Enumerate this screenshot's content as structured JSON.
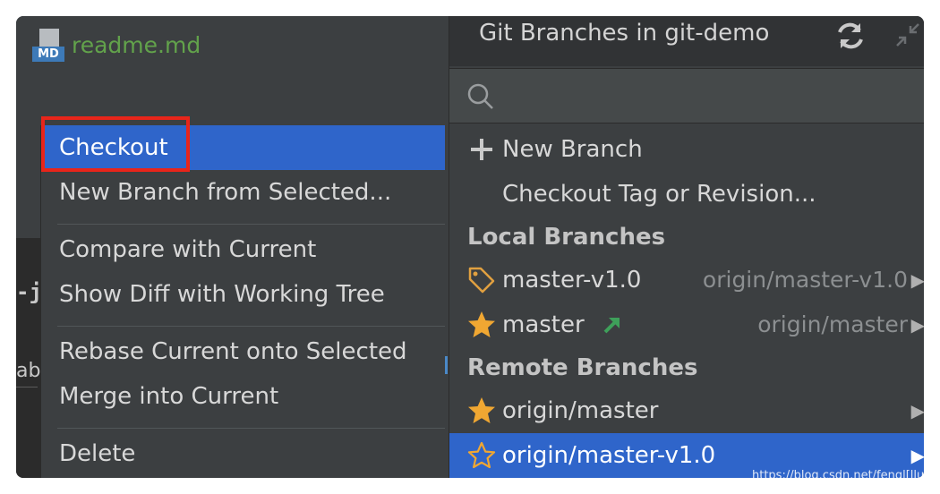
{
  "editor": {
    "file_name": "readme.md",
    "file_badge": "MD",
    "code_fragment_1": "-j",
    "code_fragment_2": "ab"
  },
  "context_menu": {
    "items": [
      {
        "label": "Checkout",
        "selected": true
      },
      {
        "label": "New Branch from Selected..."
      },
      {
        "label": "Compare with Current"
      },
      {
        "label": "Show Diff with Working Tree"
      },
      {
        "label": "Rebase Current onto Selected"
      },
      {
        "label": "Merge into Current"
      },
      {
        "label": "Delete"
      }
    ]
  },
  "branches_popup": {
    "title": "Git Branches in git-demo",
    "search_placeholder": "",
    "actions": [
      {
        "label": "New Branch",
        "icon": "plus-icon"
      },
      {
        "label": "Checkout Tag or Revision..."
      }
    ],
    "local_header": "Local Branches",
    "local": [
      {
        "name": "master-v1.0",
        "tracking": "origin/master-v1.0",
        "icon": "tag-icon"
      },
      {
        "name": "master",
        "tracking": "origin/master",
        "icon": "star-icon",
        "extra_icon": "outgoing-arrow-icon"
      }
    ],
    "remote_header": "Remote Branches",
    "remote": [
      {
        "name": "origin/master",
        "icon": "star-icon"
      },
      {
        "name": "origin/master-v1.0",
        "icon": "star-outline-icon",
        "selected": true
      }
    ]
  },
  "watermark": "https://blog.csdn.net/fengl[llu",
  "colors": {
    "selection": "#2f65ca",
    "highlight_box": "#e8251a",
    "file_name": "#62a24b",
    "star": "#f0a732",
    "arrow": "#3ea05a"
  }
}
